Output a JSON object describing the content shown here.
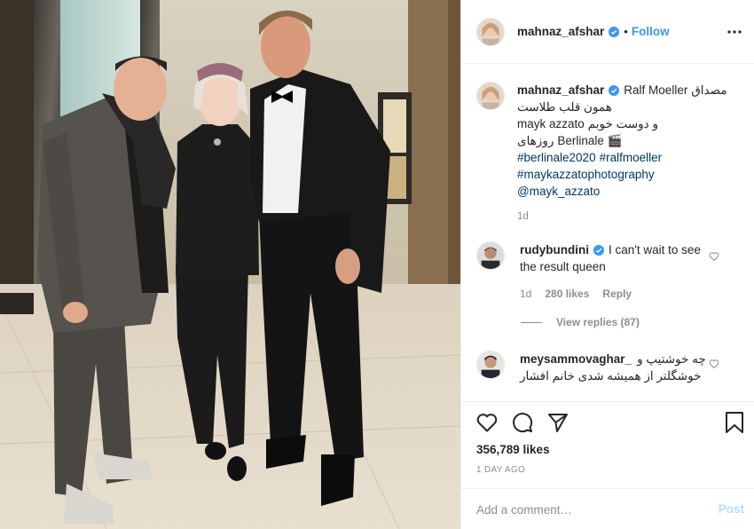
{
  "post": {
    "author": "mahnaz_afshar",
    "verified": true,
    "follow_label": "Follow",
    "separator": "•",
    "more_icon": "more-options-icon"
  },
  "caption": {
    "author": "mahnaz_afshar",
    "mention": "Ralf Moeller",
    "line1_text": "مصداق",
    "line2": "همون قلب طلاست",
    "line3_mention": "mayk azzato",
    "line3_text": "و دوست خوبم",
    "line4_text": "روزهای",
    "line4_word": "Berlinale",
    "line4_emoji": "🎬",
    "hashtags_line1": [
      "#berlinale2020",
      "#ralfmoeller"
    ],
    "hashtag_line2": "#maykazzatophotography",
    "mention_line": "@mayk_azzato",
    "time": "1d"
  },
  "comments": [
    {
      "author": "rudybundini",
      "verified": true,
      "text_part1": "I can't wait to see",
      "text_part2": "the result queen",
      "time": "1d",
      "likes": "280 likes",
      "reply_label": "Reply"
    },
    {
      "author": "meysammovaghar_",
      "verified": false,
      "text_part1": "چه خوشتیپ و",
      "text_part2": "خوشگلتر از همیشه شدی خانم افشار"
    }
  ],
  "view_replies": "View replies (87)",
  "actions": {
    "like_icon": "heart-icon",
    "comment_icon": "comment-icon",
    "share_icon": "share-icon",
    "save_icon": "bookmark-icon"
  },
  "likes_count": "356,789 likes",
  "posted_ago": "1 DAY AGO",
  "add_comment": {
    "placeholder": "Add a comment…",
    "post_label": "Post"
  },
  "colors": {
    "link": "#3897f0",
    "hashtag": "#00376b",
    "muted": "#8e8e8e",
    "post_disabled": "#b2dffc",
    "verified_badge": "#3897f0"
  }
}
